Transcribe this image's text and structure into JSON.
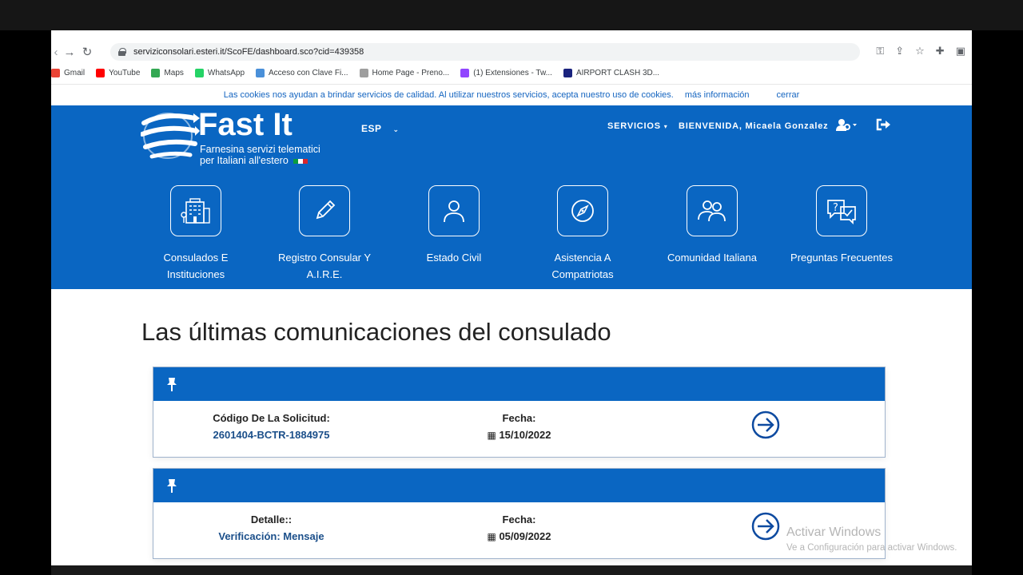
{
  "browser": {
    "url": "serviziconsolari.esteri.it/ScoFE/dashboard.sco?cid=439358",
    "bookmarks": [
      {
        "label": "Gmail",
        "color": "#ea4335"
      },
      {
        "label": "YouTube",
        "color": "#ff0000"
      },
      {
        "label": "Maps",
        "color": "#34a853"
      },
      {
        "label": "WhatsApp",
        "color": "#25d366"
      },
      {
        "label": "Acceso con Clave Fi...",
        "color": "#4a90d9"
      },
      {
        "label": "Home Page - Preno...",
        "color": "#9e9e9e"
      },
      {
        "label": "(1) Extensiones - Tw...",
        "color": "#9146ff"
      },
      {
        "label": "AIRPORT CLASH 3D...",
        "color": "#1a237e"
      }
    ]
  },
  "cookie_bar": {
    "text": "Las cookies nos ayudan a brindar servicios de calidad. Al utilizar nuestros servicios, acepta nuestro uso de cookies.",
    "more": "más información",
    "close": "cerrar"
  },
  "header": {
    "logo_title": "Fast It",
    "logo_sub_1": "Farnesina servizi telematici",
    "logo_sub_2": "per Italiani all'estero",
    "language": "ESP",
    "servicios": "SERVICIOS",
    "welcome": "BIENVENIDA, Micaela Gonzalez",
    "accent": "#0a66c2"
  },
  "tiles": [
    {
      "line1": "Consulados E",
      "line2": "Instituciones",
      "icon": "building-icon"
    },
    {
      "line1": "Registro Consular Y",
      "line2": "A.I.R.E.",
      "icon": "pencil-icon"
    },
    {
      "line1": "Estado Civil",
      "line2": "",
      "icon": "person-icon"
    },
    {
      "line1": "Asistencia A",
      "line2": "Compatriotas",
      "icon": "compass-icon"
    },
    {
      "line1": "Comunidad Italiana",
      "line2": "",
      "icon": "people-icon"
    },
    {
      "line1": "Preguntas Frecuentes",
      "line2": "",
      "icon": "faq-icon"
    }
  ],
  "main": {
    "heading": "Las últimas comunicaciones del consulado",
    "cards": [
      {
        "label": "Código De La Solicitud:",
        "value": "2601404-BCTR-1884975",
        "date_label": "Fecha:",
        "date": "15/10/2022"
      },
      {
        "label": "Detalle::",
        "value": "Verificación: Mensaje",
        "date_label": "Fecha:",
        "date": "05/09/2022"
      }
    ]
  },
  "watermark": {
    "line1": "Activar Windows",
    "line2": "Ve a Configuración para activar Windows."
  }
}
